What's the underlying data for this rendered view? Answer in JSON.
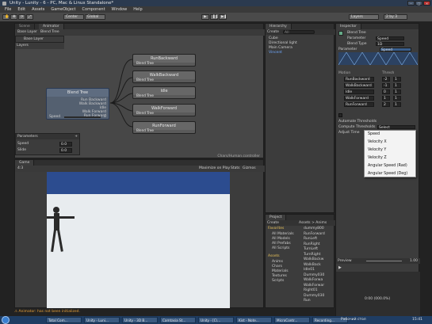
{
  "window": {
    "title": "Unity - Lunity - 6 - PC, Mac & Linux Standalone*"
  },
  "menu": [
    "File",
    "Edit",
    "Assets",
    "GameObject",
    "Component",
    "Window",
    "Help"
  ],
  "toolbar": {
    "center": "Center",
    "global": "Global",
    "layers": "Layers",
    "layout": "2 by 3"
  },
  "animator": {
    "tabs": [
      "Scene",
      "Animator"
    ],
    "breadcrumb": [
      "Base Layer",
      "Blend Tree"
    ],
    "layers_label": "Layers",
    "parameters_label": "Parameters",
    "parameters": [
      {
        "name": "Speed",
        "value": "0.0"
      },
      {
        "name": "Slide",
        "value": "0.0"
      }
    ],
    "footer_path": "Chars/Human.controller",
    "blend_tree_node": {
      "title": "Blend Tree",
      "children": [
        "Run Backward",
        "Walk Backward",
        "Idle",
        "Walk Forward",
        "Run Forward"
      ],
      "param": "Speed",
      "value": "0"
    },
    "motion_nodes": [
      {
        "title": "RunBackward",
        "label": "Blend Tree"
      },
      {
        "title": "WalkBackward",
        "label": "Blend Tree"
      },
      {
        "title": "Idle",
        "label": "Blend Tree"
      },
      {
        "title": "WalkForward",
        "label": "Blend Tree"
      },
      {
        "title": "RunForward",
        "label": "Blend Tree"
      }
    ]
  },
  "hierarchy": {
    "tab": "Hierarchy",
    "create": "Create",
    "search_placeholder": "All",
    "items": [
      "Cube",
      "Directional light",
      "Main Camera",
      "Vincent"
    ]
  },
  "inspector": {
    "tab": "Inspector",
    "object": "Blend Tree",
    "parameter_label": "Parameter",
    "parameter_value": "Speed",
    "blend_type_label": "Blend Type",
    "blend_type_value": "1D",
    "motion_header": "Motion",
    "thresh_header": "Thresh",
    "motions": [
      {
        "name": "RunBackward",
        "thresh": "-2",
        "speed": "1"
      },
      {
        "name": "WalkBackward",
        "thresh": "-1",
        "speed": "1"
      },
      {
        "name": "Idle",
        "thresh": "0",
        "speed": "1"
      },
      {
        "name": "WalkForward",
        "thresh": "1",
        "speed": "1"
      },
      {
        "name": "RunForward",
        "thresh": "2",
        "speed": "1"
      }
    ],
    "automate_label": "Automate Thresholds",
    "compute_label": "Compute Thresholds",
    "compute_value": "Select",
    "adjust_label": "Adjust Time",
    "dropdown_options": [
      "Speed",
      "Velocity X",
      "Velocity Y",
      "Velocity Z",
      "Angular Speed (Rad)",
      "Angular Speed (Deg)"
    ],
    "preview_label": "Preview",
    "preview_speed": "1.00",
    "preview_time": "0:00 (000.0%)"
  },
  "game": {
    "tab": "Game",
    "aspect": "4:3",
    "options": [
      "Maximize on Play",
      "Stats",
      "Gizmos"
    ]
  },
  "project": {
    "tab": "Project",
    "create": "Create",
    "breadcrumb": "Assets > Anims",
    "favorites_label": "Favorites",
    "favorites": [
      "All Materials",
      "All Models",
      "All Prefabs",
      "All Scripts"
    ],
    "assets_label": "Assets",
    "folders": [
      "Anims",
      "Chars",
      "Materials",
      "Textures",
      "Scripts"
    ],
    "files": [
      "dummy800",
      "RunForward",
      "RunLeft",
      "RunRight",
      "TurnLeft",
      "TurnRight",
      "WalkBackw",
      "WalkBack",
      "Idle01",
      "Dummy030",
      "WalkForwa",
      "WalkForwar",
      "Right01",
      "Dummy030",
      "Run"
    ]
  },
  "status": {
    "message": "Animator: has not been initialized."
  },
  "taskbar": {
    "items": [
      "Total Com...",
      "Unity - Luni...",
      "Unity - 3D B...",
      "Camtasia St...",
      "Unity - [C\\...",
      "Kist - Note...",
      "MicroContr...",
      "Recording..."
    ],
    "tray_label": "Рабочий стол",
    "clock": "15:41"
  }
}
